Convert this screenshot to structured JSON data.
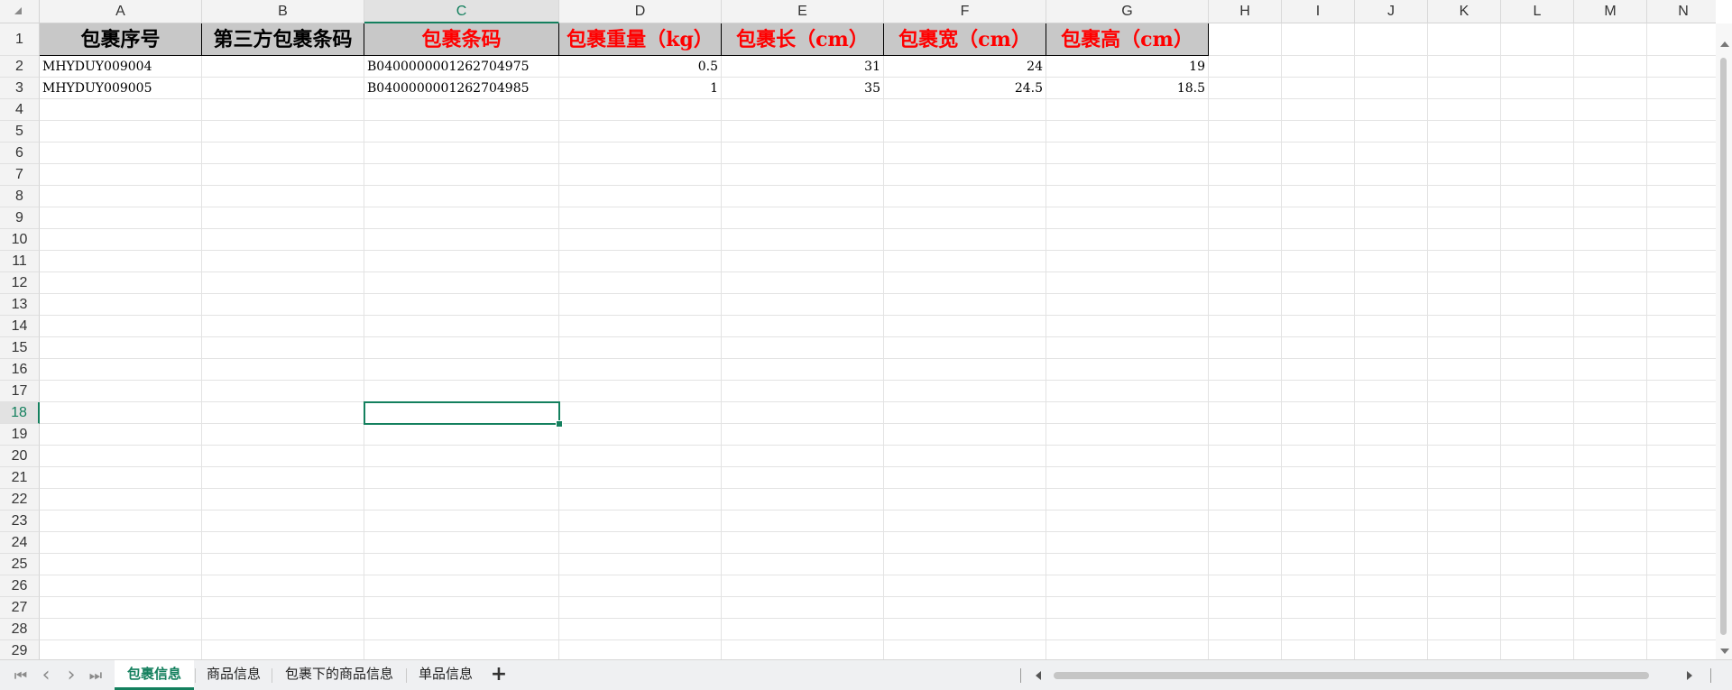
{
  "spreadsheet": {
    "columns": [
      "A",
      "B",
      "C",
      "D",
      "E",
      "F",
      "G",
      "H",
      "I",
      "J",
      "K",
      "L",
      "M",
      "N"
    ],
    "active_column": "C",
    "rows": [
      "1",
      "2",
      "3",
      "4",
      "5",
      "6",
      "7",
      "8",
      "9",
      "10",
      "11",
      "12",
      "13",
      "14",
      "15",
      "16",
      "17",
      "18",
      "19",
      "20",
      "21",
      "22",
      "23",
      "24",
      "25",
      "26",
      "27",
      "28",
      "29"
    ],
    "active_row": "18",
    "selected_cell": "C18",
    "header_row": [
      {
        "text": "包裹序号",
        "color": "#000000"
      },
      {
        "text": "第三方包裹条码",
        "color": "#000000"
      },
      {
        "text": "包裹条码",
        "color": "#ff0000"
      },
      {
        "text": "包裹重量（kg）",
        "color": "#ff0000"
      },
      {
        "text": "包裹长（cm）",
        "color": "#ff0000"
      },
      {
        "text": "包裹宽（cm）",
        "color": "#ff0000"
      },
      {
        "text": "包裹高（cm）",
        "color": "#ff0000"
      }
    ],
    "data_rows": [
      {
        "package_no": "MHYDUY009004",
        "third_party_code": "",
        "barcode": "B0400000001262704975",
        "weight": "0.5",
        "length": "31",
        "width": "24",
        "height": "19"
      },
      {
        "package_no": "MHYDUY009005",
        "third_party_code": "",
        "barcode": "B0400000001262704985",
        "weight": "1",
        "length": "35",
        "width": "24.5",
        "height": "18.5"
      }
    ]
  },
  "sheet_tabs": [
    {
      "label": "包裹信息",
      "active": true
    },
    {
      "label": "商品信息",
      "active": false
    },
    {
      "label": "包裹下的商品信息",
      "active": false
    },
    {
      "label": "单品信息",
      "active": false
    }
  ],
  "nav": {
    "first": "⏮",
    "prev": "‹",
    "next": "›",
    "last": "⏭",
    "add_sheet": "+"
  },
  "icons": {
    "corner": "select-all-triangle-icon",
    "add": "plus-icon"
  },
  "colors": {
    "accent": "#14805e",
    "header_fill": "#c8c8c8",
    "header_red_text": "#ff0000"
  }
}
